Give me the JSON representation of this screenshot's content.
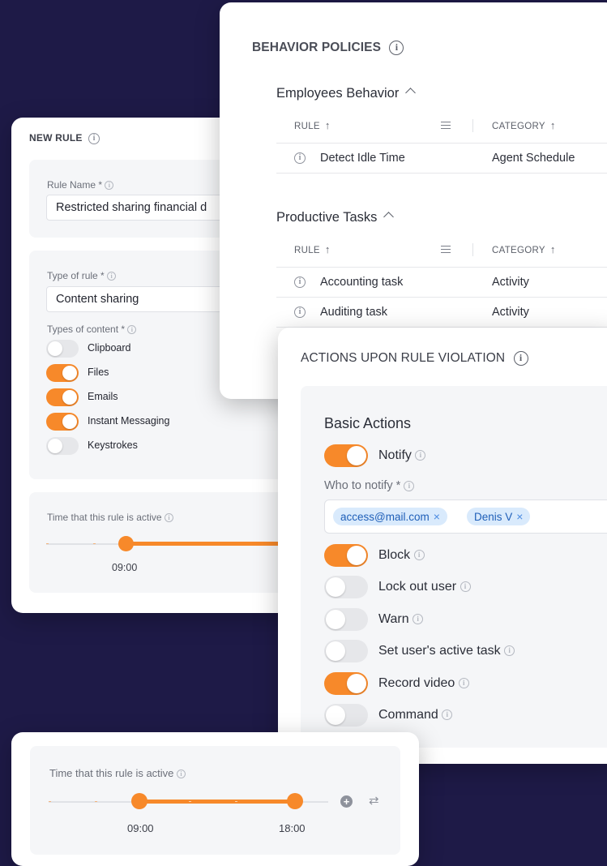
{
  "new_rule": {
    "title": "NEW RULE",
    "rule_name_label": "Rule Name *",
    "rule_name_value": "Restricted sharing financial d",
    "type_of_rule_label": "Type of rule *",
    "type_of_rule_value": "Content sharing",
    "types_of_content_label": "Types of content *",
    "content_types": [
      {
        "label": "Clipboard",
        "on": false
      },
      {
        "label": "Files",
        "on": true
      },
      {
        "label": "Emails",
        "on": true
      },
      {
        "label": "Instant Messaging",
        "on": true
      },
      {
        "label": "Keystrokes",
        "on": false
      }
    ],
    "time_label": "Time that this rule is active",
    "time_start": "09:00"
  },
  "policies": {
    "title": "BEHAVIOR POLICIES",
    "sections": [
      {
        "title": "Employees Behavior",
        "col_rule": "RULE",
        "col_category": "CATEGORY",
        "rows": [
          {
            "rule": "Detect Idle Time",
            "category": "Agent Schedule"
          }
        ]
      },
      {
        "title": "Productive Tasks",
        "col_rule": "RULE",
        "col_category": "CATEGORY",
        "rows": [
          {
            "rule": "Accounting task",
            "category": "Activity"
          },
          {
            "rule": "Auditing task",
            "category": "Activity"
          }
        ]
      }
    ]
  },
  "actions": {
    "title": "ACTIONS UPON RULE VIOLATION",
    "basic_title": "Basic Actions",
    "notify_label": "Notify",
    "notify_on": true,
    "who_label": "Who to notify *",
    "recipients": [
      "access@mail.com",
      "Denis V"
    ],
    "items": [
      {
        "label": "Block",
        "on": true
      },
      {
        "label": "Lock out user",
        "on": false
      },
      {
        "label": "Warn",
        "on": false
      },
      {
        "label": "Set user's active task",
        "on": false
      },
      {
        "label": "Record video",
        "on": true
      },
      {
        "label": "Command",
        "on": false
      }
    ]
  },
  "time_card": {
    "label": "Time that this rule is active",
    "start": "09:00",
    "end": "18:00"
  },
  "colors": {
    "background": "#1e1a47",
    "accent": "#f7892a",
    "chip_bg": "#d9eafc",
    "chip_text": "#1f5fb8"
  }
}
